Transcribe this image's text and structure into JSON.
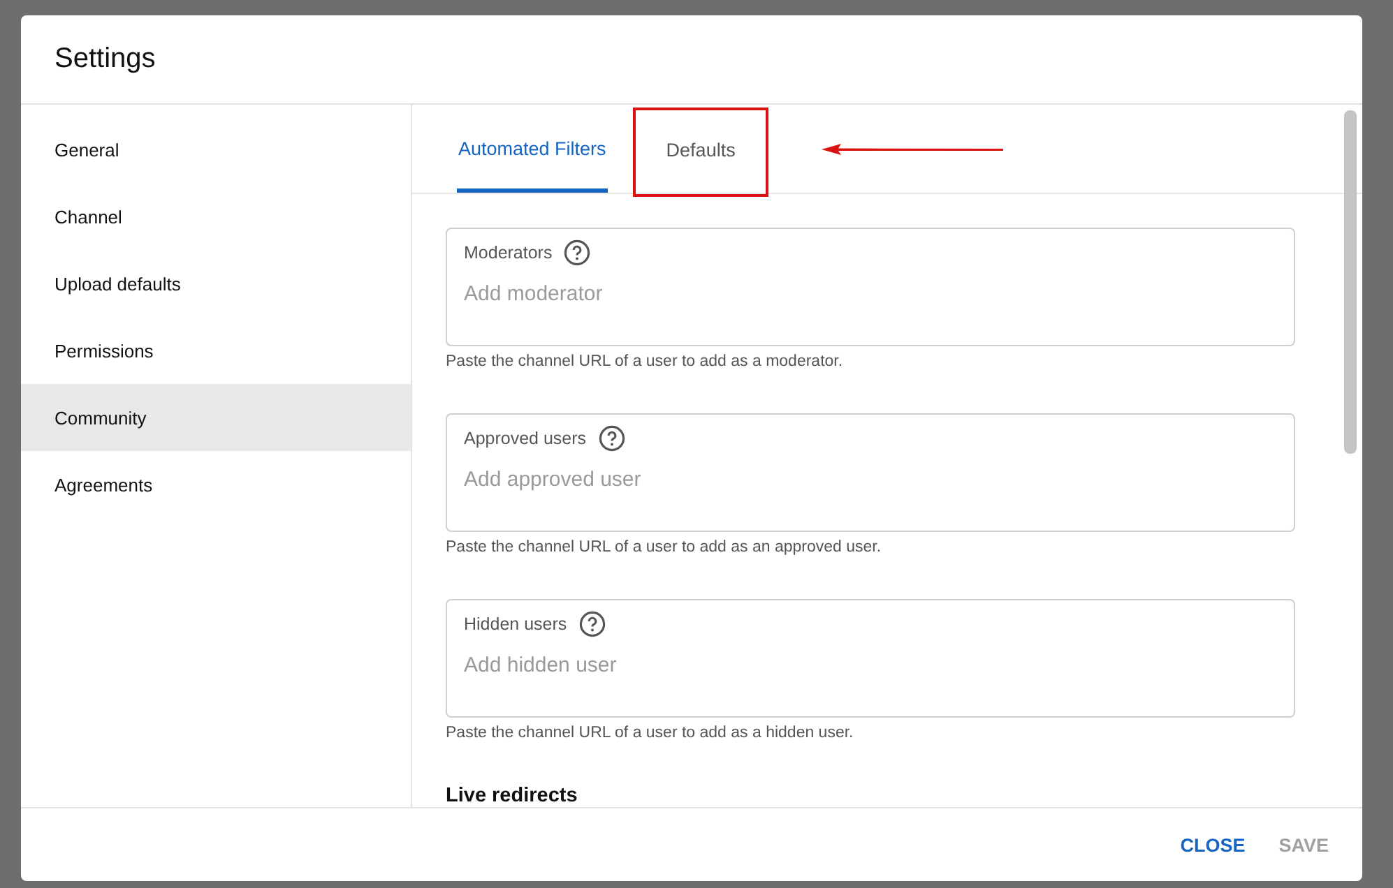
{
  "dialog": {
    "title": "Settings"
  },
  "sidebar": {
    "items": [
      {
        "label": "General",
        "selected": false
      },
      {
        "label": "Channel",
        "selected": false
      },
      {
        "label": "Upload defaults",
        "selected": false
      },
      {
        "label": "Permissions",
        "selected": false
      },
      {
        "label": "Community",
        "selected": true
      },
      {
        "label": "Agreements",
        "selected": false
      }
    ]
  },
  "tabs": [
    {
      "label": "Automated Filters",
      "selected": true,
      "highlighted": false
    },
    {
      "label": "Defaults",
      "selected": false,
      "highlighted": true
    }
  ],
  "annotation_arrow": true,
  "fields": [
    {
      "label": "Moderators",
      "placeholder": "Add moderator",
      "helper": "Paste the channel URL of a user to add as a moderator."
    },
    {
      "label": "Approved users",
      "placeholder": "Add approved user",
      "helper": "Paste the channel URL of a user to add as an approved user."
    },
    {
      "label": "Hidden users",
      "placeholder": "Add hidden user",
      "helper": "Paste the channel URL of a user to add as a hidden user."
    }
  ],
  "section_heading": "Live redirects",
  "buttons": [
    {
      "label": "CLOSE",
      "disabled": false
    },
    {
      "label": "SAVE",
      "disabled": true
    }
  ]
}
